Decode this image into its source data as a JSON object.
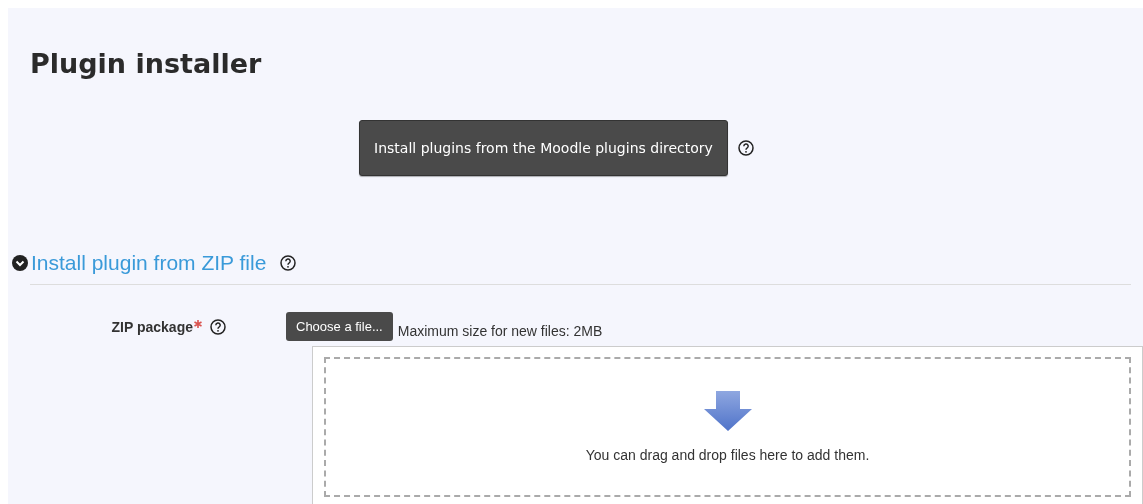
{
  "page": {
    "title": "Plugin installer"
  },
  "directory_button": {
    "label": "Install plugins from the Moodle plugins directory"
  },
  "section": {
    "title": "Install plugin from ZIP file",
    "expanded": true,
    "field": {
      "label": "ZIP package",
      "required": true,
      "button": "Choose a file...",
      "hint": "Maximum size for new files: 2MB",
      "dropzone_text": "You can drag and drop files here to add them."
    }
  }
}
